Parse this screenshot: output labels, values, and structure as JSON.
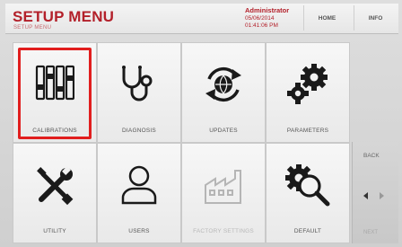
{
  "header": {
    "title": "SETUP MENU",
    "breadcrumb": "SETUP MENU",
    "user": "Administrator",
    "date": "05/06/2014",
    "time": "01:41:06 PM",
    "home_label": "HOME",
    "info_label": "INFO"
  },
  "tiles": [
    {
      "label": "CALIBRATIONS",
      "icon": "sliders-icon",
      "selected": true
    },
    {
      "label": "DIAGNOSIS",
      "icon": "stethoscope-icon"
    },
    {
      "label": "UPDATES",
      "icon": "refresh-globe-icon"
    },
    {
      "label": "PARAMETERS",
      "icon": "gears-icon"
    },
    {
      "label": "UTILITY",
      "icon": "wrench-screwdriver-icon"
    },
    {
      "label": "USERS",
      "icon": "user-icon"
    },
    {
      "label": "FACTORY SETTINGS",
      "icon": "factory-icon",
      "disabled": true
    },
    {
      "label": "DEFAULT",
      "icon": "gear-magnifier-icon"
    }
  ],
  "nav": {
    "back_label": "BACK",
    "next_label": "NEXT"
  },
  "colors": {
    "accent": "#b3202a",
    "selection": "#e11e1e"
  }
}
